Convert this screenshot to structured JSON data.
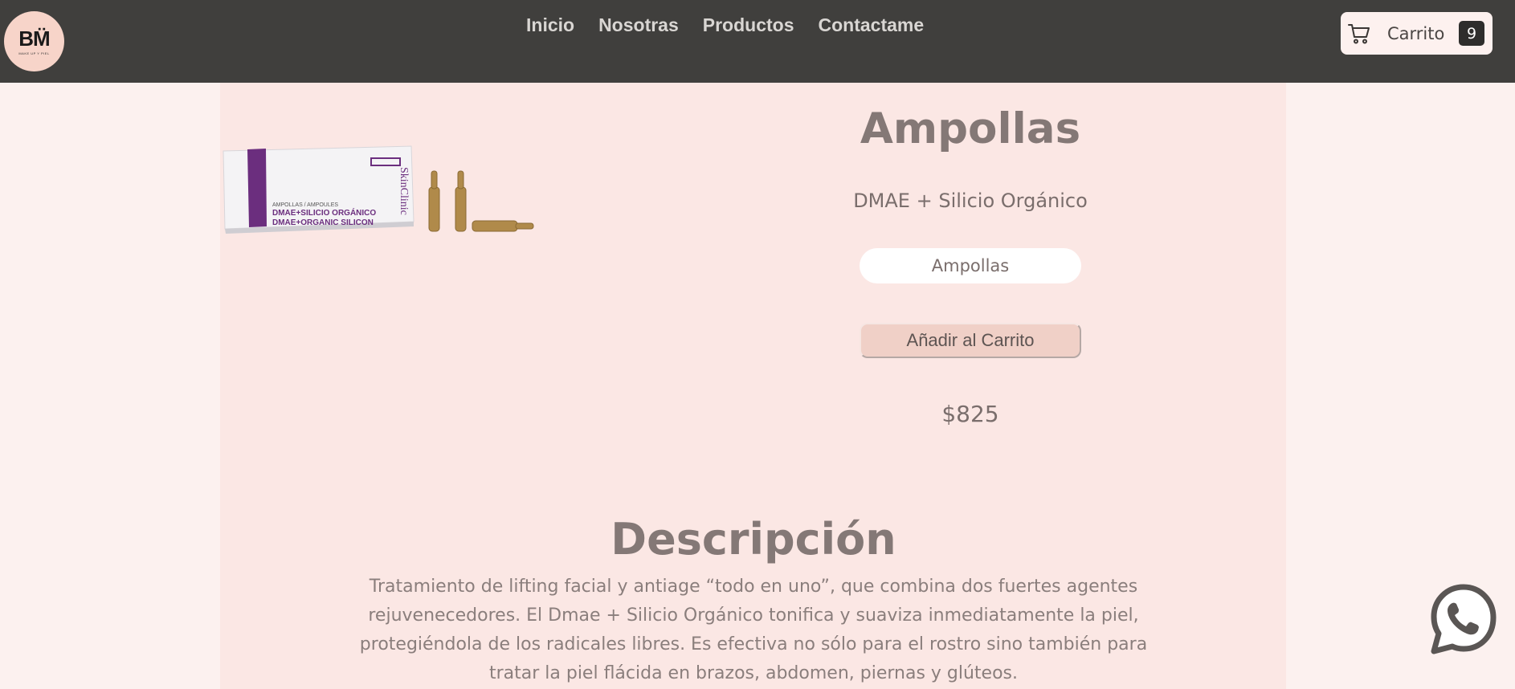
{
  "logo": {
    "main": "BM̈",
    "sub": "MAKE UP Y PIEL"
  },
  "nav": {
    "links": [
      "Inicio",
      "Nosotras",
      "Productos",
      "Contactame"
    ]
  },
  "cart": {
    "label": "Carrito",
    "count": "9",
    "icon": "cart-icon"
  },
  "product": {
    "title": "Ampollas",
    "subtitle": "DMAE + Silicio Orgánico",
    "category": "Ampollas",
    "add_to_cart_label": "Añadir al Carrito",
    "price": "$825",
    "image": {
      "brand": "SkinClinic",
      "box_line1": "AMPOLLAS / AMPOULES",
      "box_line2": "DMAE+SILICIO ORGÁNICO",
      "box_line3": "DMAE+ORGANIC SILICON"
    }
  },
  "description": {
    "title": "Descripción",
    "text": "Tratamiento de lifting facial y antiage “todo en uno”, que combina dos fuertes agentes rejuvenecedores. El Dmae + Silicio Orgánico tonifica y suaviza inmediatamente la piel, protegiéndola de los radicales libres. Es efectiva no sólo para el rostro sino también para tratar la piel flácida en brazos, abdomen, piernas y glúteos."
  },
  "whatsapp": {
    "icon": "whatsapp-icon"
  },
  "colors": {
    "navbar": "#403f3d",
    "page_bg": "#fcf1ef",
    "panel_bg": "#fbe7e4",
    "button_bg": "#f0d0c7",
    "box_purple": "#6b2e7e"
  }
}
